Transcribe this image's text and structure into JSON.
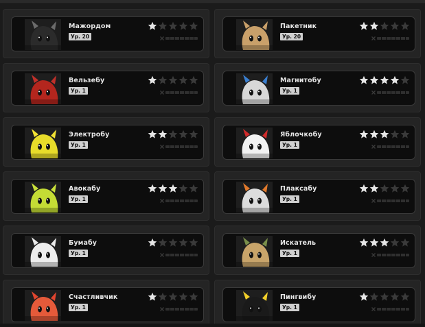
{
  "collection": {
    "items": [
      {
        "name": "Мажордом",
        "level": "Ур. 20",
        "stars": 1,
        "max_stars": 5,
        "progress": 0,
        "accent": "#6b6b6b",
        "skin": "#2b2b2b",
        "icon": "majordomo-portrait-icon"
      },
      {
        "name": "Пакетник",
        "level": "Ур. 20",
        "stars": 2,
        "max_stars": 5,
        "progress": 0,
        "accent": "#c9a06a",
        "skin": "#c9a06a",
        "icon": "paper-bag-portrait-icon"
      },
      {
        "name": "Вельзебу",
        "level": "Ур. 1",
        "stars": 1,
        "max_stars": 5,
        "progress": 0,
        "accent": "#c0302a",
        "skin": "#b3261e",
        "icon": "devil-portrait-icon"
      },
      {
        "name": "Магнитобу",
        "level": "Ур. 1",
        "stars": 4,
        "max_stars": 5,
        "progress": 0,
        "accent": "#3a7fd0",
        "skin": "#d8d8d8",
        "icon": "magnet-portrait-icon"
      },
      {
        "name": "Электробу",
        "level": "Ур. 1",
        "stars": 2,
        "max_stars": 5,
        "progress": 0,
        "accent": "#f2e233",
        "skin": "#e8dc2a",
        "icon": "electric-portrait-icon"
      },
      {
        "name": "Яблочкобу",
        "level": "Ур. 1",
        "stars": 3,
        "max_stars": 5,
        "progress": 0,
        "accent": "#d02a2a",
        "skin": "#f2f2f2",
        "icon": "apple-target-portrait-icon"
      },
      {
        "name": "Авокабу",
        "level": "Ур. 1",
        "stars": 3,
        "max_stars": 5,
        "progress": 0,
        "accent": "#c8df3a",
        "skin": "#c4dc35",
        "icon": "avocado-portrait-icon"
      },
      {
        "name": "Плаксабу",
        "level": "Ур. 1",
        "stars": 2,
        "max_stars": 5,
        "progress": 0,
        "accent": "#e27a2c",
        "skin": "#dcdcdc",
        "icon": "crybaby-portrait-icon"
      },
      {
        "name": "Бумабу",
        "level": "Ур. 1",
        "stars": 1,
        "max_stars": 5,
        "progress": 0,
        "accent": "#e8e8e8",
        "skin": "#ededed",
        "icon": "paper-portrait-icon"
      },
      {
        "name": "Искатель",
        "level": "Ур. 1",
        "stars": 3,
        "max_stars": 5,
        "progress": 0,
        "accent": "#7a8f4a",
        "skin": "#c8a46a",
        "icon": "explorer-portrait-icon"
      },
      {
        "name": "Счастливчик",
        "level": "Ур. 1",
        "stars": 1,
        "max_stars": 5,
        "progress": 0,
        "accent": "#e0452f",
        "skin": "#e55a3a",
        "icon": "lucky-portrait-icon"
      },
      {
        "name": "Пингвибу",
        "level": "Ур. 1",
        "stars": 1,
        "max_stars": 5,
        "progress": 0,
        "accent": "#f2cf2a",
        "skin": "#1a1a1a",
        "icon": "penguin-portrait-icon"
      }
    ]
  },
  "colors": {
    "star_filled": "#e6e6e6",
    "star_empty": "#3a3a3a"
  }
}
